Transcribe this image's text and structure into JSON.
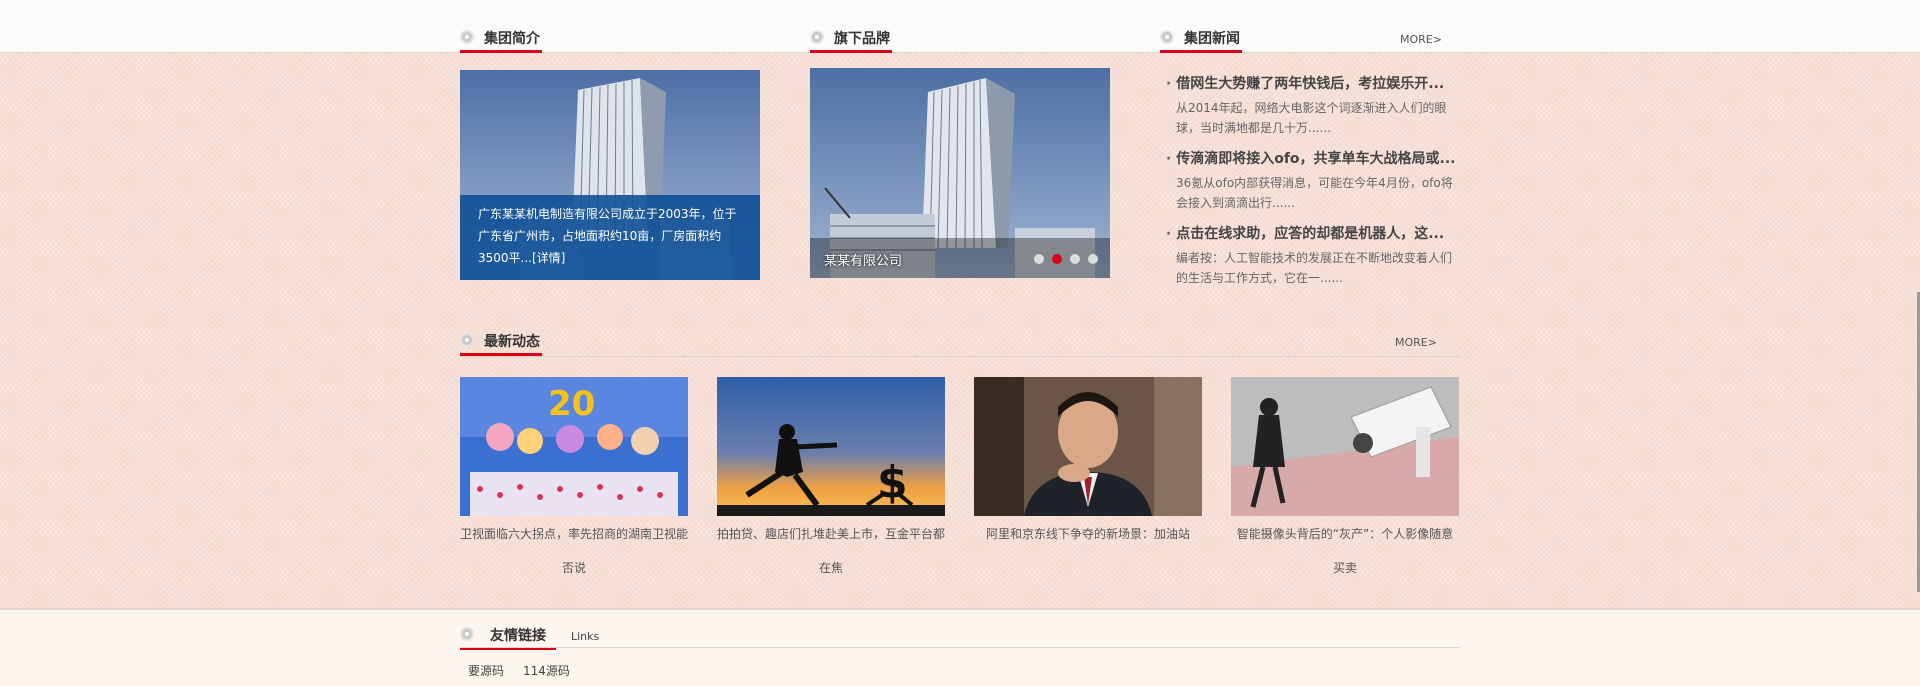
{
  "sections": {
    "intro": {
      "title": "集团简介",
      "text": "广东某某机电制造有限公司成立于2003年，位于广东省广州市，占地面积约10亩，厂房面积约3500平...",
      "detail_label": "[详情]"
    },
    "brands": {
      "title": "旗下品牌",
      "slides": [
        {
          "caption": "某某有限公司"
        }
      ]
    },
    "news": {
      "title": "集团新闻",
      "more_label": "MORE>",
      "items": [
        {
          "title": "借网生大势赚了两年快钱后，考拉娱乐开...",
          "desc": "从2014年起，网络大电影这个词逐渐进入人们的眼球，当时满地都是几十万......"
        },
        {
          "title": "传滴滴即将接入ofo，共享单车大战格局或...",
          "desc": "36氪从ofo内部获得消息，可能在今年4月份，ofo将会接入到滴滴出行......"
        },
        {
          "title": "点击在线求助，应答的却都是机器人，这...",
          "desc": "编者按：人工智能技术的发展正在不断地改变着人们的生活与工作方式，它在一......"
        }
      ]
    },
    "latest": {
      "title": "最新动态",
      "more_label": "MORE>",
      "items": [
        {
          "caption": "卫视面临六大拐点，率先招商的湖南卫视能否说"
        },
        {
          "caption": "拍拍贷、趣店们扎堆赴美上市，互金平台都在焦"
        },
        {
          "caption": "阿里和京东线下争夺的新场景：加油站"
        },
        {
          "caption": "智能摄像头背后的“灰产”：个人影像随意买卖"
        }
      ]
    },
    "links": {
      "title": "友情链接",
      "subtitle": "Links",
      "items": [
        "要源码",
        "114源码"
      ]
    }
  },
  "colors": {
    "accent": "#d9001b",
    "caption_bg": "#0e5096",
    "page_bg": "#f6e0d6"
  }
}
